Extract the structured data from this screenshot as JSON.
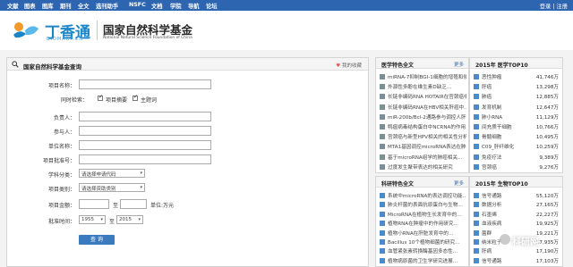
{
  "topnav": {
    "items": [
      "文献",
      "图表",
      "图库",
      "期刊",
      "全文",
      "选刊助手",
      "NSFC",
      "文档",
      "学院",
      "导航",
      "论坛"
    ],
    "auth": "登录 | 注册"
  },
  "header": {
    "logo_cn": "丁香通",
    "logo_en": "BIOMART.CN",
    "org_cn": "国家自然科学基金",
    "org_en": "National Natural Science Foundation of China"
  },
  "search": {
    "title": "国家自然科学基金查询",
    "favorite": "我的收藏",
    "project_name_label": "项目名称：",
    "scope_label": "同时检索：",
    "scope_opt1": "项目摘要",
    "scope_opt2": "主题词",
    "leader_label": "负责人：",
    "member_label": "参与人：",
    "unit_label": "单位名称：",
    "grant_no_label": "项目批准号：",
    "discipline_label": "学科分类：",
    "discipline_value": "请选择申请代码",
    "category_label": "项目类别：",
    "category_value": "请选择资助类别",
    "amount_label": "项目金额：",
    "to1": "至",
    "unit_suffix": "单位:万元",
    "year_label": "批准时间：",
    "year_from": "1955",
    "to2": "至",
    "year_to": "2015",
    "submit": "查 询"
  },
  "medical_news": {
    "title": "医学特色全文",
    "more": "更多",
    "items": [
      "miRNA-7抑制BGI-1细胞的增殖和侵袭…",
      "外源性多酚在维生素D缺乏…",
      "长链非编码RNA HOTAIR在宫颈癌中…",
      "长链非编码RNA在HBV相关肝癌中…",
      "miR-200b/Bcl-2通路参与调控人肝…",
      "鸭瘟病毒结构蛋白中NCRNA的作用…",
      "宫颈癌与新型HPV相关的相关性分析…",
      "MTA1基因调控microRNA表达在肿瘤…",
      "基于microRNA组学的肺癌相关…",
      "过度发生聚带表达的相关研究"
    ]
  },
  "medical_top": {
    "title": "2015年 医学TOP10",
    "items": [
      {
        "name": "恶性肿瘤",
        "value": "41,746万"
      },
      {
        "name": "肝癌",
        "value": "13,298万"
      },
      {
        "name": "肺癌",
        "value": "12,885万"
      },
      {
        "name": "发育机制",
        "value": "12,647万"
      },
      {
        "name": "肺小RNA",
        "value": "11,129万"
      },
      {
        "name": "间充质干细胞",
        "value": "10,766万"
      },
      {
        "name": "骨髓细胞",
        "value": "10,495万"
      },
      {
        "name": "C09_肝纤维化",
        "value": "10,259万"
      },
      {
        "name": "免疫疗法",
        "value": "9,389万"
      },
      {
        "name": "宫颈癌",
        "value": "9,276万"
      }
    ]
  },
  "bio_news": {
    "title": "科研特色全文",
    "more": "更多",
    "items": [
      "系统中microRNA的表达调控功能…",
      "肺炎杆菌的表面抗原蛋白与生物…",
      "MicroRNA在植物生长发育中的…",
      "植物RNA在肿瘤中的作用研究…",
      "植物小RNA在肝脏发育中的…",
      "Bacillus 10个植物细菌的研究…",
      "血管紧张素转换酶基因多态性…",
      "植物病原菌的卫生学研究进展…",
      "肺癌干细胞在肿瘤发生中作用…"
    ]
  },
  "bio_top": {
    "title": "2015年 生物TOP10",
    "items": [
      {
        "name": "信号通路",
        "value": "55,120万"
      },
      {
        "name": "数据分析",
        "value": "27,165万"
      },
      {
        "name": "石墨烯",
        "value": "22,227万"
      },
      {
        "name": "血液疾病",
        "value": "19,925万"
      },
      {
        "name": "菌群",
        "value": "19,221万"
      },
      {
        "name": "纳米粒子",
        "value": "17,935万"
      },
      {
        "name": "肝病",
        "value": "17,190万"
      },
      {
        "name": "信号通路",
        "value": "17,103万"
      },
      {
        "name": "蛋白质",
        "value": "16,863万"
      }
    ]
  },
  "watermark": "科研网",
  "colors": {
    "nav": "#2e65b0",
    "accent": "#1d86c8",
    "bullet": "#4d8ac9"
  }
}
